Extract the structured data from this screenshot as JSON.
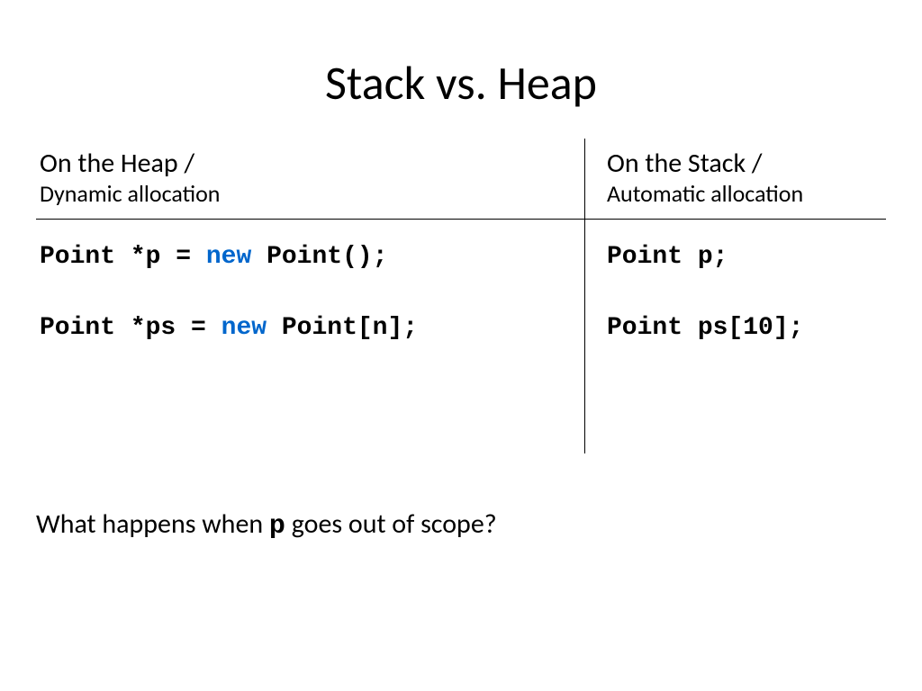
{
  "title": "Stack vs. Heap",
  "columns": {
    "heap": {
      "main": "On the Heap /",
      "sub": "Dynamic allocation"
    },
    "stack": {
      "main": "On the Stack /",
      "sub": "Automatic allocation"
    }
  },
  "code": {
    "heap1_a": "Point *p = ",
    "heap1_kw": "new",
    "heap1_b": " Point();",
    "heap2_a": "Point *ps = ",
    "heap2_kw": "new",
    "heap2_b": " Point[n];",
    "stack1": "Point p;",
    "stack2": "Point ps[10];"
  },
  "question": {
    "a": "What happens when ",
    "var": "p",
    "b": " goes out of scope?"
  }
}
